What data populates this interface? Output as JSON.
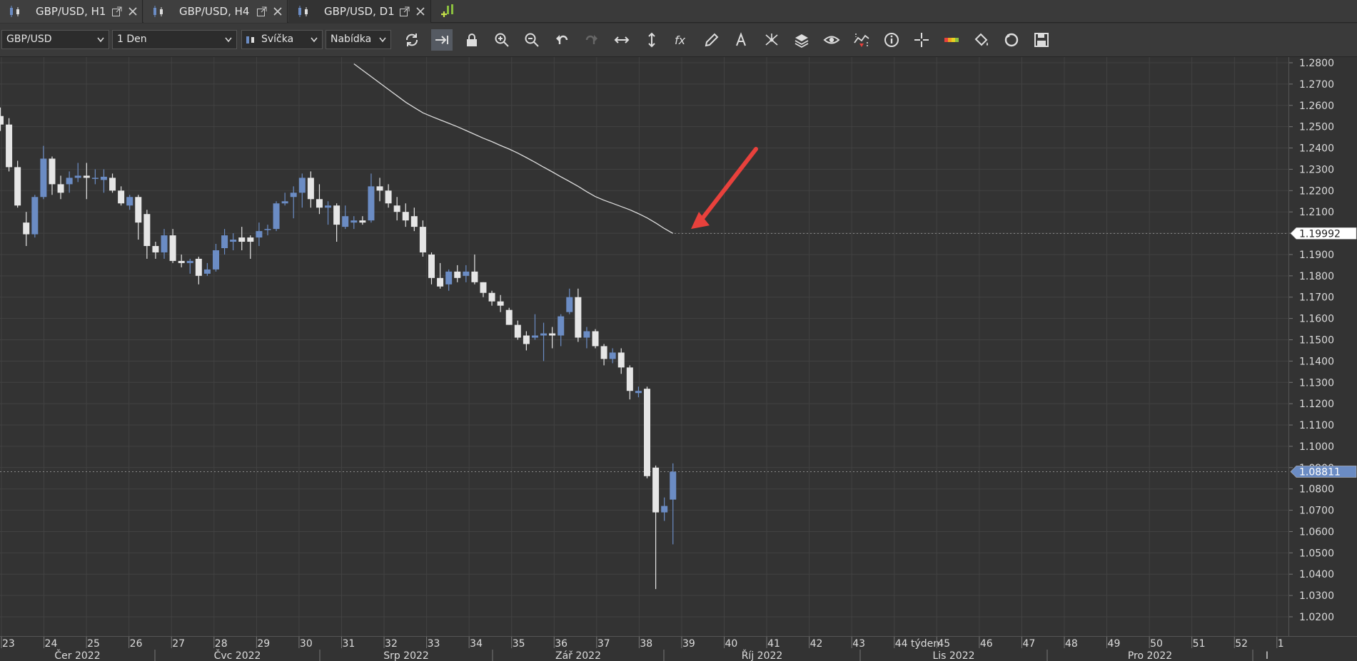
{
  "tabs": [
    {
      "label": "GBP/USD, H1",
      "active": false
    },
    {
      "label": "GBP/USD, H4",
      "active": false
    },
    {
      "label": "GBP/USD, D1",
      "active": true
    }
  ],
  "toolbar": {
    "symbol": "GBP/USD",
    "timeframe": "1 Den",
    "chart_style": "Svíčka",
    "price_side": "Nabídka",
    "tools": [
      "refresh-icon",
      "autoscroll-icon",
      "lock-icon",
      "zoom-in-icon",
      "zoom-out-icon",
      "undo-icon",
      "redo-icon",
      "fit-horizontal-icon",
      "fit-vertical-icon",
      "indicators-fx-icon",
      "pencil-icon",
      "text-tool-icon",
      "drawing-objects-icon",
      "layers-icon",
      "visibility-eye-icon",
      "trade-markers-icon",
      "info-icon",
      "crosshair-icon",
      "color-theme-icon",
      "paint-bucket-icon",
      "reset-icon",
      "save-icon"
    ]
  },
  "colors": {
    "background": "#333333",
    "grid": "#424242",
    "bull": "#6b8cc4",
    "bear": "#e6e6e6",
    "ma_line": "#dddddd",
    "arrow": "#e8413c",
    "price_tag_bg": "#6b8cc4"
  },
  "chart_data": {
    "type": "candlestick",
    "symbol": "GBP/USD",
    "timeframe": "D1",
    "ylim": [
      1.012,
      1.284
    ],
    "y_ticks": [
      "1.2800",
      "1.2700",
      "1.2600",
      "1.2500",
      "1.2400",
      "1.2300",
      "1.2200",
      "1.2100",
      "1.2000",
      "1.1900",
      "1.1800",
      "1.1700",
      "1.1600",
      "1.1500",
      "1.1400",
      "1.1300",
      "1.1200",
      "1.1100",
      "1.1000",
      "1.0900",
      "1.0800",
      "1.0700",
      "1.0600",
      "1.0500",
      "1.0400",
      "1.0300",
      "1.0200"
    ],
    "week_labels": [
      "23",
      "24",
      "25",
      "26",
      "27",
      "28",
      "29",
      "30",
      "31",
      "32",
      "33",
      "34",
      "35",
      "36",
      "37",
      "38",
      "39",
      "40",
      "41",
      "42",
      "43",
      "44 týden",
      "45",
      "46",
      "47",
      "48",
      "49",
      "50",
      "51",
      "52",
      "1"
    ],
    "month_labels": [
      "Čer 2022",
      "Čvc 2022",
      "Srp 2022",
      "Zář 2022",
      "Říj 2022",
      "Lis 2022",
      "Pro 2022",
      "I"
    ],
    "candles": [
      {
        "o": 1.255,
        "h": 1.259,
        "l": 1.248,
        "c": 1.251
      },
      {
        "o": 1.251,
        "h": 1.254,
        "l": 1.229,
        "c": 1.231
      },
      {
        "o": 1.231,
        "h": 1.234,
        "l": 1.212,
        "c": 1.213
      },
      {
        "o": 1.205,
        "h": 1.21,
        "l": 1.194,
        "c": 1.1995
      },
      {
        "o": 1.1995,
        "h": 1.218,
        "l": 1.198,
        "c": 1.217
      },
      {
        "o": 1.217,
        "h": 1.241,
        "l": 1.216,
        "c": 1.235
      },
      {
        "o": 1.235,
        "h": 1.236,
        "l": 1.218,
        "c": 1.223
      },
      {
        "o": 1.223,
        "h": 1.227,
        "l": 1.216,
        "c": 1.219
      },
      {
        "o": 1.223,
        "h": 1.229,
        "l": 1.219,
        "c": 1.226
      },
      {
        "o": 1.226,
        "h": 1.233,
        "l": 1.224,
        "c": 1.227
      },
      {
        "o": 1.227,
        "h": 1.233,
        "l": 1.216,
        "c": 1.226
      },
      {
        "o": 1.226,
        "h": 1.23,
        "l": 1.223,
        "c": 1.226
      },
      {
        "o": 1.225,
        "h": 1.23,
        "l": 1.219,
        "c": 1.2265
      },
      {
        "o": 1.226,
        "h": 1.228,
        "l": 1.219,
        "c": 1.22
      },
      {
        "o": 1.22,
        "h": 1.222,
        "l": 1.213,
        "c": 1.214
      },
      {
        "o": 1.213,
        "h": 1.218,
        "l": 1.211,
        "c": 1.217
      },
      {
        "o": 1.217,
        "h": 1.218,
        "l": 1.197,
        "c": 1.205
      },
      {
        "o": 1.209,
        "h": 1.211,
        "l": 1.188,
        "c": 1.194
      },
      {
        "o": 1.194,
        "h": 1.196,
        "l": 1.188,
        "c": 1.191
      },
      {
        "o": 1.191,
        "h": 1.202,
        "l": 1.188,
        "c": 1.199
      },
      {
        "o": 1.199,
        "h": 1.202,
        "l": 1.186,
        "c": 1.187
      },
      {
        "o": 1.187,
        "h": 1.19,
        "l": 1.184,
        "c": 1.186
      },
      {
        "o": 1.186,
        "h": 1.188,
        "l": 1.181,
        "c": 1.187
      },
      {
        "o": 1.188,
        "h": 1.189,
        "l": 1.176,
        "c": 1.18
      },
      {
        "o": 1.181,
        "h": 1.186,
        "l": 1.18,
        "c": 1.183
      },
      {
        "o": 1.183,
        "h": 1.195,
        "l": 1.182,
        "c": 1.192
      },
      {
        "o": 1.193,
        "h": 1.202,
        "l": 1.19,
        "c": 1.199
      },
      {
        "o": 1.196,
        "h": 1.2,
        "l": 1.192,
        "c": 1.197
      },
      {
        "o": 1.198,
        "h": 1.203,
        "l": 1.192,
        "c": 1.196
      },
      {
        "o": 1.198,
        "h": 1.199,
        "l": 1.188,
        "c": 1.196
      },
      {
        "o": 1.198,
        "h": 1.205,
        "l": 1.194,
        "c": 1.201
      },
      {
        "o": 1.202,
        "h": 1.204,
        "l": 1.199,
        "c": 1.202
      },
      {
        "o": 1.202,
        "h": 1.215,
        "l": 1.201,
        "c": 1.214
      },
      {
        "o": 1.214,
        "h": 1.219,
        "l": 1.213,
        "c": 1.215
      },
      {
        "o": 1.217,
        "h": 1.222,
        "l": 1.207,
        "c": 1.219
      },
      {
        "o": 1.219,
        "h": 1.228,
        "l": 1.212,
        "c": 1.226
      },
      {
        "o": 1.226,
        "h": 1.229,
        "l": 1.212,
        "c": 1.216
      },
      {
        "o": 1.216,
        "h": 1.223,
        "l": 1.209,
        "c": 1.212
      },
      {
        "o": 1.212,
        "h": 1.215,
        "l": 1.204,
        "c": 1.213
      },
      {
        "o": 1.213,
        "h": 1.214,
        "l": 1.196,
        "c": 1.204
      },
      {
        "o": 1.203,
        "h": 1.213,
        "l": 1.202,
        "c": 1.208
      },
      {
        "o": 1.205,
        "h": 1.208,
        "l": 1.202,
        "c": 1.206
      },
      {
        "o": 1.206,
        "h": 1.208,
        "l": 1.204,
        "c": 1.205
      },
      {
        "o": 1.206,
        "h": 1.228,
        "l": 1.205,
        "c": 1.222
      },
      {
        "o": 1.222,
        "h": 1.226,
        "l": 1.215,
        "c": 1.22
      },
      {
        "o": 1.22,
        "h": 1.223,
        "l": 1.212,
        "c": 1.214
      },
      {
        "o": 1.213,
        "h": 1.217,
        "l": 1.206,
        "c": 1.21
      },
      {
        "o": 1.21,
        "h": 1.214,
        "l": 1.203,
        "c": 1.206
      },
      {
        "o": 1.208,
        "h": 1.212,
        "l": 1.201,
        "c": 1.203
      },
      {
        "o": 1.203,
        "h": 1.206,
        "l": 1.189,
        "c": 1.191
      },
      {
        "o": 1.19,
        "h": 1.191,
        "l": 1.176,
        "c": 1.179
      },
      {
        "o": 1.179,
        "h": 1.186,
        "l": 1.174,
        "c": 1.175
      },
      {
        "o": 1.176,
        "h": 1.183,
        "l": 1.173,
        "c": 1.182
      },
      {
        "o": 1.182,
        "h": 1.185,
        "l": 1.177,
        "c": 1.179
      },
      {
        "o": 1.18,
        "h": 1.185,
        "l": 1.177,
        "c": 1.182
      },
      {
        "o": 1.182,
        "h": 1.19,
        "l": 1.176,
        "c": 1.177
      },
      {
        "o": 1.177,
        "h": 1.177,
        "l": 1.17,
        "c": 1.172
      },
      {
        "o": 1.172,
        "h": 1.173,
        "l": 1.166,
        "c": 1.168
      },
      {
        "o": 1.168,
        "h": 1.171,
        "l": 1.163,
        "c": 1.166
      },
      {
        "o": 1.164,
        "h": 1.165,
        "l": 1.157,
        "c": 1.157
      },
      {
        "o": 1.157,
        "h": 1.159,
        "l": 1.15,
        "c": 1.151
      },
      {
        "o": 1.152,
        "h": 1.154,
        "l": 1.145,
        "c": 1.148
      },
      {
        "o": 1.151,
        "h": 1.162,
        "l": 1.15,
        "c": 1.152
      },
      {
        "o": 1.152,
        "h": 1.158,
        "l": 1.14,
        "c": 1.153
      },
      {
        "o": 1.153,
        "h": 1.156,
        "l": 1.146,
        "c": 1.152
      },
      {
        "o": 1.152,
        "h": 1.162,
        "l": 1.147,
        "c": 1.161
      },
      {
        "o": 1.163,
        "h": 1.174,
        "l": 1.162,
        "c": 1.17
      },
      {
        "o": 1.17,
        "h": 1.174,
        "l": 1.149,
        "c": 1.151
      },
      {
        "o": 1.151,
        "h": 1.156,
        "l": 1.146,
        "c": 1.154
      },
      {
        "o": 1.154,
        "h": 1.155,
        "l": 1.146,
        "c": 1.147
      },
      {
        "o": 1.147,
        "h": 1.148,
        "l": 1.138,
        "c": 1.141
      },
      {
        "o": 1.141,
        "h": 1.146,
        "l": 1.139,
        "c": 1.144
      },
      {
        "o": 1.144,
        "h": 1.146,
        "l": 1.134,
        "c": 1.137
      },
      {
        "o": 1.137,
        "h": 1.138,
        "l": 1.122,
        "c": 1.126
      },
      {
        "o": 1.125,
        "h": 1.128,
        "l": 1.123,
        "c": 1.126
      },
      {
        "o": 1.127,
        "h": 1.128,
        "l": 1.085,
        "c": 1.086
      },
      {
        "o": 1.09,
        "h": 1.091,
        "l": 1.033,
        "c": 1.069
      },
      {
        "o": 1.069,
        "h": 1.076,
        "l": 1.065,
        "c": 1.072
      },
      {
        "o": 1.075,
        "h": 1.092,
        "l": 1.054,
        "c": 1.0881
      }
    ],
    "moving_average": [
      1.2795,
      1.2765,
      1.2735,
      1.2705,
      1.2675,
      1.2645,
      1.2615,
      1.259,
      1.2565,
      1.2548,
      1.2532,
      1.2516,
      1.25,
      1.2482,
      1.2464,
      1.2446,
      1.243,
      1.2412,
      1.2395,
      1.2376,
      1.2355,
      1.2333,
      1.231,
      1.2288,
      1.2265,
      1.2243,
      1.222,
      1.2195,
      1.2172,
      1.2155,
      1.214,
      1.2125,
      1.211,
      1.2092,
      1.2072,
      1.2048,
      1.2022,
      1.19992
    ],
    "last_price": "1.08811",
    "ma_value": "1.19992"
  }
}
